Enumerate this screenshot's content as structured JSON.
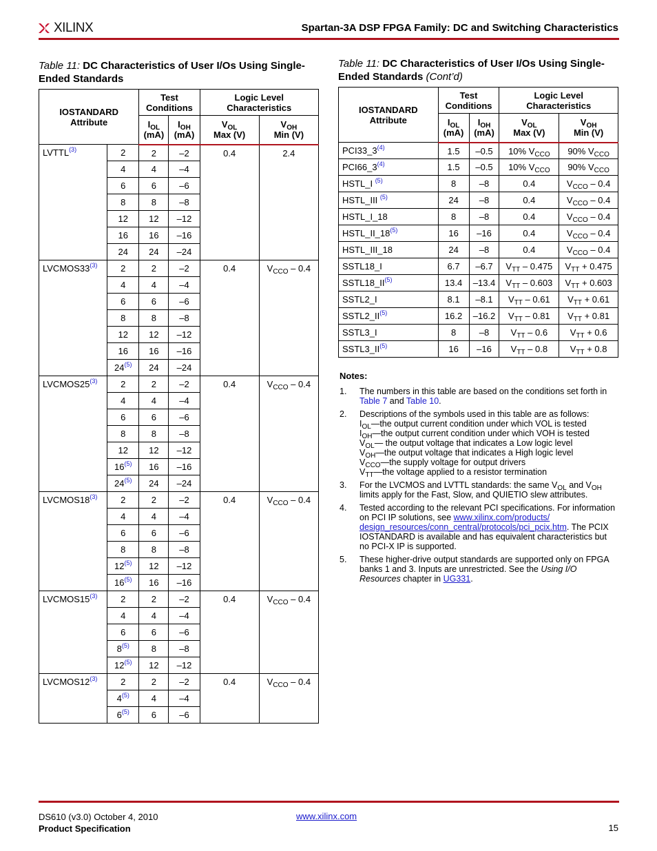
{
  "header": {
    "logo_text": "XILINX",
    "title": "Spartan-3A DSP FPGA Family: DC and Switching Characteristics",
    "accent_color": "#b0141e"
  },
  "left_table": {
    "caption_prefix": "Table  11:",
    "caption_title": "DC Characteristics of User I/Os Using Single-Ended Standards",
    "headers": {
      "iostandard": "IOSTANDARD",
      "attribute": "Attribute",
      "test": "Test",
      "conditions": "Conditions",
      "logic": "Logic Level",
      "characteristics": "Characteristics",
      "iol": "I",
      "iol_sub": "OL",
      "iol_unit": "(mA)",
      "ioh": "I",
      "ioh_sub": "OH",
      "ioh_unit": "(mA)",
      "vol": "V",
      "vol_sub": "OL",
      "vol_unit": "Max (V)",
      "voh": "V",
      "voh_sub": "OH",
      "voh_unit": "Min (V)"
    },
    "groups": [
      {
        "name": "LVTTL",
        "fn": "(3)",
        "vol": "0.4",
        "voh": "2.4",
        "voh_sub": "",
        "voh_suffix": "",
        "rows": [
          [
            "2",
            "",
            "2",
            "–2"
          ],
          [
            "4",
            "",
            "4",
            "–4"
          ],
          [
            "6",
            "",
            "6",
            "–6"
          ],
          [
            "8",
            "",
            "8",
            "–8"
          ],
          [
            "12",
            "",
            "12",
            "–12"
          ],
          [
            "16",
            "",
            "16",
            "–16"
          ],
          [
            "24",
            "",
            "24",
            "–24"
          ]
        ]
      },
      {
        "name": "LVCMOS33",
        "fn": "(3)",
        "vol": "0.4",
        "voh": "V",
        "voh_sub": "CCO",
        "voh_suffix": " – 0.4",
        "rows": [
          [
            "2",
            "",
            "2",
            "–2"
          ],
          [
            "4",
            "",
            "4",
            "–4"
          ],
          [
            "6",
            "",
            "6",
            "–6"
          ],
          [
            "8",
            "",
            "8",
            "–8"
          ],
          [
            "12",
            "",
            "12",
            "–12"
          ],
          [
            "16",
            "",
            "16",
            "–16"
          ],
          [
            "24",
            "(5)",
            "24",
            "–24"
          ]
        ]
      },
      {
        "name": "LVCMOS25",
        "fn": "(3)",
        "vol": "0.4",
        "voh": "V",
        "voh_sub": "CCO",
        "voh_suffix": " – 0.4",
        "rows": [
          [
            "2",
            "",
            "2",
            "–2"
          ],
          [
            "4",
            "",
            "4",
            "–4"
          ],
          [
            "6",
            "",
            "6",
            "–6"
          ],
          [
            "8",
            "",
            "8",
            "–8"
          ],
          [
            "12",
            "",
            "12",
            "–12"
          ],
          [
            "16",
            "(5)",
            "16",
            "–16"
          ],
          [
            "24",
            "(5)",
            "24",
            "–24"
          ]
        ]
      },
      {
        "name": "LVCMOS18",
        "fn": "(3)",
        "vol": "0.4",
        "voh": "V",
        "voh_sub": "CCO",
        "voh_suffix": " – 0.4",
        "rows": [
          [
            "2",
            "",
            "2",
            "–2"
          ],
          [
            "4",
            "",
            "4",
            "–4"
          ],
          [
            "6",
            "",
            "6",
            "–6"
          ],
          [
            "8",
            "",
            "8",
            "–8"
          ],
          [
            "12",
            "(5)",
            "12",
            "–12"
          ],
          [
            "16",
            "(5)",
            "16",
            "–16"
          ]
        ]
      },
      {
        "name": "LVCMOS15",
        "fn": "(3)",
        "vol": "0.4",
        "voh": "V",
        "voh_sub": "CCO",
        "voh_suffix": " – 0.4",
        "rows": [
          [
            "2",
            "",
            "2",
            "–2"
          ],
          [
            "4",
            "",
            "4",
            "–4"
          ],
          [
            "6",
            "",
            "6",
            "–6"
          ],
          [
            "8",
            "(5)",
            "8",
            "–8"
          ],
          [
            "12",
            "(5)",
            "12",
            "–12"
          ]
        ]
      },
      {
        "name": "LVCMOS12",
        "fn": "(3)",
        "vol": "0.4",
        "voh": "V",
        "voh_sub": "CCO",
        "voh_suffix": " – 0.4",
        "rows": [
          [
            "2",
            "",
            "2",
            "–2"
          ],
          [
            "4",
            "(5)",
            "4",
            "–4"
          ],
          [
            "6",
            "(5)",
            "6",
            "–6"
          ]
        ]
      }
    ]
  },
  "right_table": {
    "caption_prefix": "Table  11:",
    "caption_title": "DC Characteristics of User I/Os Using Single-Ended Standards",
    "caption_suffix": "(Cont’d)",
    "rows": [
      {
        "name": "PCI33_3",
        "fn": "(4)",
        "iol": "1.5",
        "ioh": "–0.5",
        "vol_pre": "10% V",
        "vol_sub": "CCO",
        "vol_post": "",
        "voh_pre": "90% V",
        "voh_sub": "CCO",
        "voh_post": ""
      },
      {
        "name": "PCI66_3",
        "fn": "(4)",
        "iol": "1.5",
        "ioh": "–0.5",
        "vol_pre": "10% V",
        "vol_sub": "CCO",
        "vol_post": "",
        "voh_pre": "90% V",
        "voh_sub": "CCO",
        "voh_post": ""
      },
      {
        "name": "HSTL_I ",
        "fn": "(5)",
        "iol": "8",
        "ioh": "–8",
        "vol_pre": "0.4",
        "vol_sub": "",
        "vol_post": "",
        "voh_pre": "V",
        "voh_sub": "CCO",
        "voh_post": " – 0.4"
      },
      {
        "name": "HSTL_III ",
        "fn": "(5)",
        "iol": "24",
        "ioh": "–8",
        "vol_pre": "0.4",
        "vol_sub": "",
        "vol_post": "",
        "voh_pre": "V",
        "voh_sub": "CCO",
        "voh_post": " – 0.4"
      },
      {
        "name": "HSTL_I_18",
        "fn": "",
        "iol": "8",
        "ioh": "–8",
        "vol_pre": "0.4",
        "vol_sub": "",
        "vol_post": "",
        "voh_pre": "V",
        "voh_sub": "CCO",
        "voh_post": " – 0.4"
      },
      {
        "name": "HSTL_II_18",
        "fn": "(5)",
        "iol": "16",
        "ioh": "–16",
        "vol_pre": "0.4",
        "vol_sub": "",
        "vol_post": "",
        "voh_pre": "V",
        "voh_sub": "CCO",
        "voh_post": " – 0.4"
      },
      {
        "name": "HSTL_III_18",
        "fn": "",
        "iol": "24",
        "ioh": "–8",
        "vol_pre": "0.4",
        "vol_sub": "",
        "vol_post": "",
        "voh_pre": "V",
        "voh_sub": "CCO",
        "voh_post": " – 0.4"
      },
      {
        "name": "SSTL18_I",
        "fn": "",
        "iol": "6.7",
        "ioh": "–6.7",
        "vol_pre": "V",
        "vol_sub": "TT",
        "vol_post": " – 0.475",
        "voh_pre": "V",
        "voh_sub": "TT",
        "voh_post": " + 0.475"
      },
      {
        "name": "SSTL18_II",
        "fn": "(5)",
        "iol": "13.4",
        "ioh": "–13.4",
        "vol_pre": "V",
        "vol_sub": "TT",
        "vol_post": " – 0.603",
        "voh_pre": "V",
        "voh_sub": "TT",
        "voh_post": " + 0.603"
      },
      {
        "name": "SSTL2_I",
        "fn": "",
        "iol": "8.1",
        "ioh": "–8.1",
        "vol_pre": "V",
        "vol_sub": "TT",
        "vol_post": " – 0.61",
        "voh_pre": "V",
        "voh_sub": "TT",
        "voh_post": " + 0.61"
      },
      {
        "name": "SSTL2_II",
        "fn": "(5)",
        "iol": "16.2",
        "ioh": "–16.2",
        "vol_pre": "V",
        "vol_sub": "TT",
        "vol_post": " – 0.81",
        "voh_pre": "V",
        "voh_sub": "TT",
        "voh_post": " + 0.81"
      },
      {
        "name": "SSTL3_I",
        "fn": "",
        "iol": "8",
        "ioh": "–8",
        "vol_pre": "V",
        "vol_sub": "TT",
        "vol_post": " – 0.6",
        "voh_pre": "V",
        "voh_sub": "TT",
        "voh_post": " + 0.6"
      },
      {
        "name": "SSTL3_II",
        "fn": "(5)",
        "iol": "16",
        "ioh": "–16",
        "vol_pre": "V",
        "vol_sub": "TT",
        "vol_post": " – 0.8",
        "voh_pre": "V",
        "voh_sub": "TT",
        "voh_post": " + 0.8"
      }
    ]
  },
  "notes": {
    "heading": "Notes:",
    "n1": {
      "num": "1.",
      "text": "The numbers in this table are based on the conditions set forth in ",
      "link1": "Table 7",
      "mid": " and ",
      "link2": "Table 10",
      "end": "."
    },
    "n2": {
      "num": "2.",
      "intro": "Descriptions of the symbols used in this table are as follows:",
      "defs": [
        {
          "sym": "I",
          "sub": "OL",
          "text": "—the output current condition under which VOL is tested"
        },
        {
          "sym": "I",
          "sub": "OH",
          "text": "—the output current condition under which VOH is tested"
        },
        {
          "sym": "V",
          "sub": "OL",
          "text": "— the output voltage that indicates a Low logic level"
        },
        {
          "sym": "V",
          "sub": "OH",
          "text": "—the output voltage that indicates a High logic level"
        },
        {
          "sym": "V",
          "sub": "CCO",
          "text": "—the supply voltage for output drivers"
        },
        {
          "sym": "V",
          "sub": "TT",
          "text": "—the voltage applied to a resistor termination"
        }
      ]
    },
    "n3": {
      "num": "3.",
      "a": "For the LVCMOS and LVTTL standards: the same V",
      "s1": "OL",
      "b": " and V",
      "s2": "OH",
      "c": " limits apply for the Fast, Slow, and QUIETIO slew attributes."
    },
    "n4": {
      "num": "4.",
      "a": "Tested according to the relevant PCI specifications. For information on PCI IP solutions, see ",
      "link": "www.xilinx.com/products/ design_resources/conn_central/protocols/pci_pcix.htm",
      "b": ". The PCIX IOSTANDARD is available and has equivalent characteristics but no PCI-X IP is supported."
    },
    "n5": {
      "num": "5.",
      "a": "These higher-drive output standards are supported only on FPGA banks 1 and 3. Inputs are unrestricted. See the ",
      "italic": "Using I/O Resources",
      "b": " chapter in ",
      "link": "UG331",
      "c": "."
    }
  },
  "footer": {
    "doc_id": "DS610 (v3.0) October 4, 2010",
    "doc_type": "Product Specification",
    "url": "www.xilinx.com",
    "page_number": "15"
  }
}
